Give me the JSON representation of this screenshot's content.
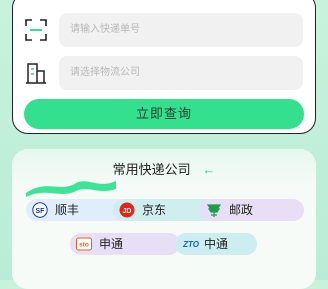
{
  "search": {
    "tracking_placeholder": "请输入快递单号",
    "company_placeholder": "请选择物流公司",
    "query_button": "立即查询"
  },
  "couriers": {
    "title": "常用快递公司",
    "arrow": "←",
    "items": [
      {
        "name": "顺丰",
        "icon": "sf-express-logo-icon"
      },
      {
        "name": "京东",
        "icon": "jd-logo-icon"
      },
      {
        "name": "邮政",
        "icon": "china-post-logo-icon"
      },
      {
        "name": "申通",
        "icon": "sto-logo-icon"
      },
      {
        "name": "中通",
        "icon": "zto-logo-icon"
      }
    ],
    "logo_text": {
      "sf": "SF",
      "jd": "JD",
      "sto": "sto",
      "zto": "ZTO"
    }
  },
  "colors": {
    "accent": "#34e08e",
    "background": "#c8f2dc",
    "sf": "#1a3c8a",
    "jd": "#e1251b",
    "post": "#1e9e4c",
    "sto": "#e0621e",
    "zto": "#1a5fc2"
  }
}
